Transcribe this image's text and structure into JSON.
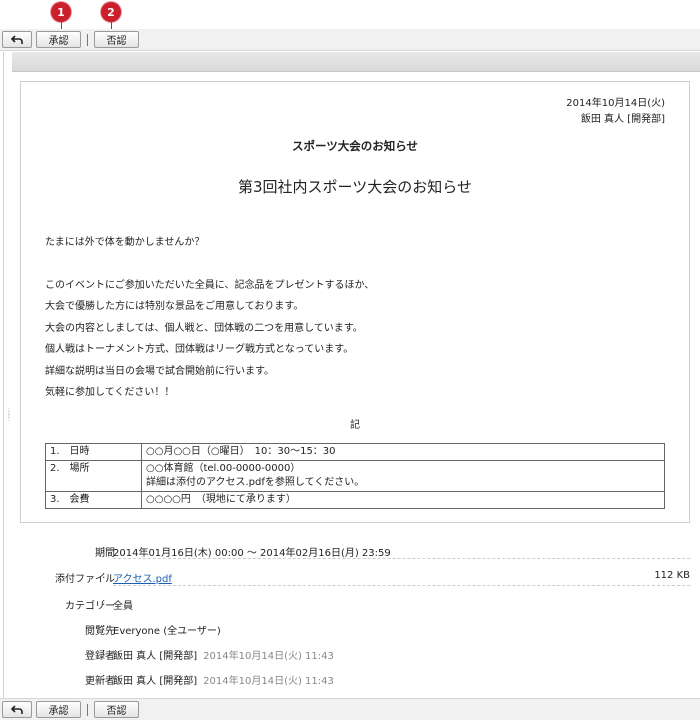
{
  "toolbar": {
    "approve_label": "承認",
    "reject_label": "否認",
    "callouts": [
      "1",
      "2"
    ]
  },
  "document": {
    "date": "2014年10月14日(火)",
    "author": "飯田 真人 [開発部]",
    "subject": "スポーツ大会のお知らせ",
    "heading": "第3回社内スポーツ大会のお知らせ",
    "greeting": "たまには外で体を動かしませんか？",
    "body_lines": [
      "このイベントにご参加いただいた全員に、記念品をプレゼントするほか、",
      "大会で優勝した方には特別な景品をご用意しております。",
      "大会の内容としましては、個人戦と、団体戦の二つを用意しています。",
      "個人戦はトーナメント方式、団体戦はリーグ戦方式となっています。",
      "詳細な説明は当日の会場で試合開始前に行います。",
      "気軽に参加してください！！"
    ],
    "ki": "記",
    "table": [
      {
        "key": "1.　日時",
        "value": "○○月○○日（○曜日）　10：30〜15：30",
        "value2": ""
      },
      {
        "key": "2.　場所",
        "value": "○○体育館（tel.00-0000-0000）",
        "value2": "詳細は添付のアクセス.pdfを参照してください。"
      },
      {
        "key": "3.　会費",
        "value": "○○○○円　（現地にて承ります）",
        "value2": ""
      }
    ]
  },
  "meta": {
    "period_label": "期間",
    "period_value": "2014年01月16日(木) 00:00 〜 2014年02月16日(月) 23:59",
    "attachment_label": "添付ファイル",
    "attachment_name": "アクセス.pdf",
    "attachment_size": "112 KB",
    "category_label": "カテゴリー",
    "category_value": "全員",
    "viewers_label": "閲覧先",
    "viewers_value": "Everyone (全ユーザー)",
    "registrant_label": "登録者",
    "registrant_name": "飯田 真人 [開発部]",
    "registrant_time": "2014年10月14日(火) 11:43",
    "updater_label": "更新者",
    "updater_name": "飯田 真人 [開発部]",
    "updater_time": "2014年10月14日(火) 11:43"
  },
  "colors": {
    "callout_red": "#cc1f2d",
    "link_blue": "#1a5fb4",
    "toolbar_bg": "#f1f1f1"
  }
}
